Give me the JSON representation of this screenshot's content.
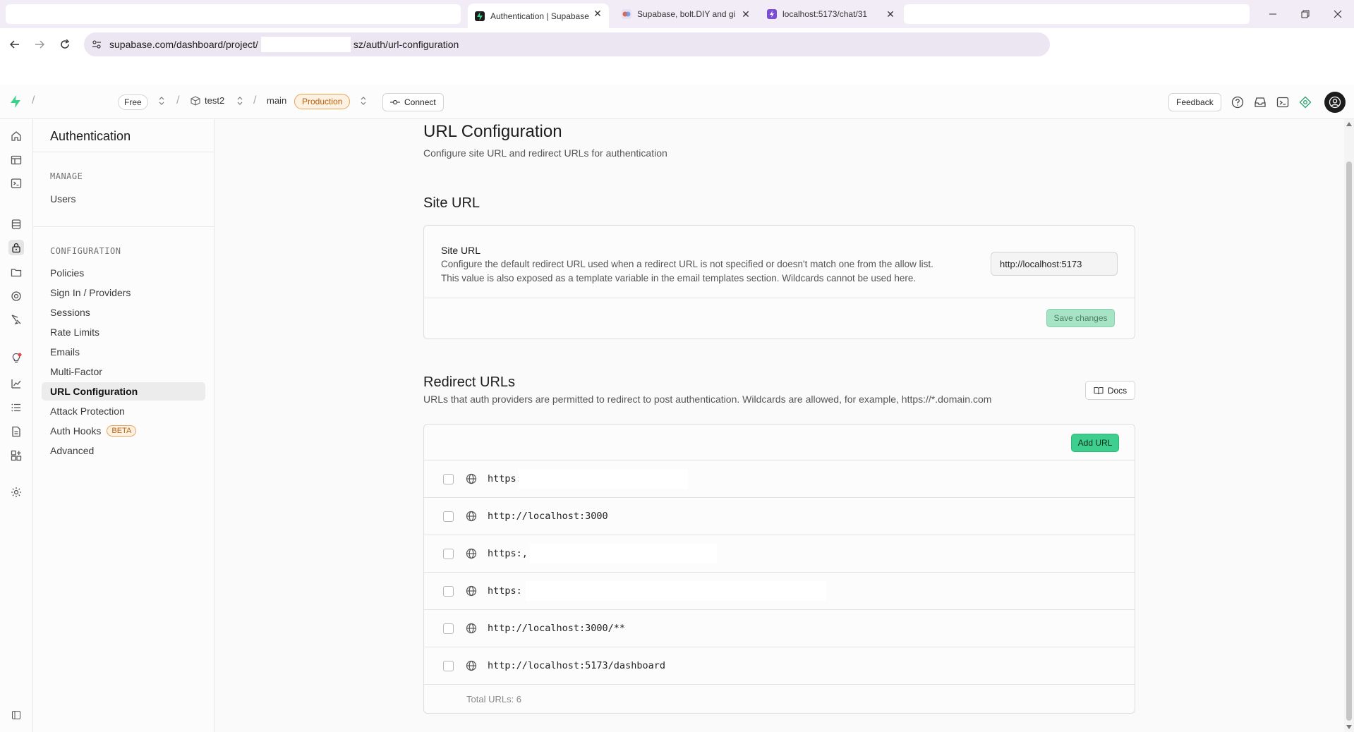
{
  "browser": {
    "tabs": [
      {
        "title": "Authentication | Supabase",
        "active": true
      },
      {
        "title": "Supabase, bolt.DIY and gi",
        "active": false
      },
      {
        "title": "localhost:5173/chat/31",
        "active": false
      }
    ],
    "url_prefix": "supabase.com/dashboard/project/",
    "url_suffix": "sz/auth/url-configuration"
  },
  "header": {
    "plan": "Free",
    "project": "test2",
    "branch": "main",
    "env": "Production",
    "connect": "Connect",
    "feedback": "Feedback"
  },
  "sidemenu": {
    "title": "Authentication",
    "manage_label": "MANAGE",
    "manage_items": [
      "Users"
    ],
    "config_label": "CONFIGURATION",
    "config_items": [
      "Policies",
      "Sign In / Providers",
      "Sessions",
      "Rate Limits",
      "Emails",
      "Multi-Factor",
      "URL Configuration",
      "Attack Protection",
      "Auth Hooks",
      "Advanced"
    ],
    "beta": "BETA"
  },
  "page": {
    "title": "URL Configuration",
    "subtitle": "Configure site URL and redirect URLs for authentication"
  },
  "site_url": {
    "heading": "Site URL",
    "label": "Site URL",
    "desc_line1": "Configure the default redirect URL used when a redirect URL is not specified or doesn't match one from the allow list.",
    "desc_line2": "This value is also exposed as a template variable in the email templates section. Wildcards cannot be used here.",
    "value": "http://localhost:5173",
    "save": "Save changes"
  },
  "redirect": {
    "heading": "Redirect URLs",
    "desc": "URLs that auth providers are permitted to redirect to post authentication. Wildcards are allowed, for example, https://*.domain.com",
    "docs": "Docs",
    "add": "Add URL",
    "urls": [
      "https:",
      "http://localhost:3000",
      "https:,",
      "https:",
      "http://localhost:3000/**",
      "http://localhost:5173/dashboard"
    ],
    "total": "Total URLs: 6"
  },
  "colors": {
    "brand": "#3ecf8e",
    "accent_warning": "#e6a45a"
  }
}
